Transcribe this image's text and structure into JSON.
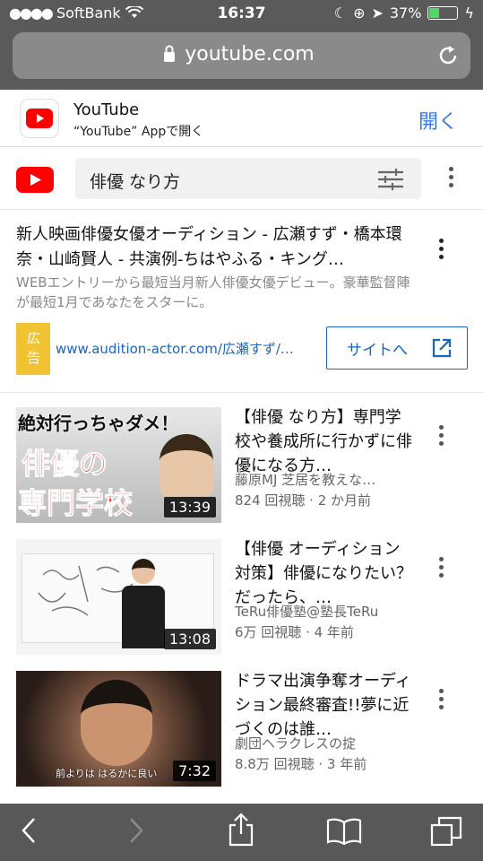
{
  "status": {
    "carrier": "SoftBank",
    "time": "16:37",
    "battery": "37%"
  },
  "browser": {
    "domain": "youtube.com"
  },
  "banner": {
    "app_name": "YouTube",
    "subtitle": "“YouTube” Appで開く",
    "open_label": "開く"
  },
  "search": {
    "query": "俳優 なり方"
  },
  "ad": {
    "title": "新人映画俳優女優オーディション - 広瀬すず・橋本環奈・山崎賢人 - 共演例-ちはやふる・キング…",
    "description": "WEBエントリーから最短当月新人俳優女優デビュー。豪華監督陣が最短1月であなたをスターに。",
    "badge": "広告",
    "url": "www.audition-actor.com/広瀬すず/…",
    "button_label": "サイトへ"
  },
  "videos": [
    {
      "title": "【俳優 なり方】専門学校や養成所に行かずに俳優になる方…",
      "channel": "藤原MJ 芝居を教えな…",
      "meta": "824 回視聴 · 2 か月前",
      "duration": "13:39",
      "thumb_text_top": "絶対行っちゃダメ！",
      "thumb_text_mid": "俳優の",
      "thumb_text_bot": "専門学校"
    },
    {
      "title": "【俳優 オーディション対策】俳優になりたい？だったら、…",
      "channel": "TeRu俳優塾@塾長TeRu",
      "meta": "6万 回視聴 · 4 年前",
      "duration": "13:08"
    },
    {
      "title": "ドラマ出演争奪オーディション最終審査!!夢に近づくのは誰…",
      "channel": "劇団ヘラクレスの掟",
      "meta": "8.8万 回視聴 · 3 年前",
      "duration": "7:32",
      "thumb_caption": "前よりは はるかに良い"
    }
  ],
  "colors": {
    "youtube_red": "#ff0000",
    "link_blue": "#1a65c0",
    "ios_blue": "#3478f6",
    "ad_badge": "#f1c232"
  }
}
